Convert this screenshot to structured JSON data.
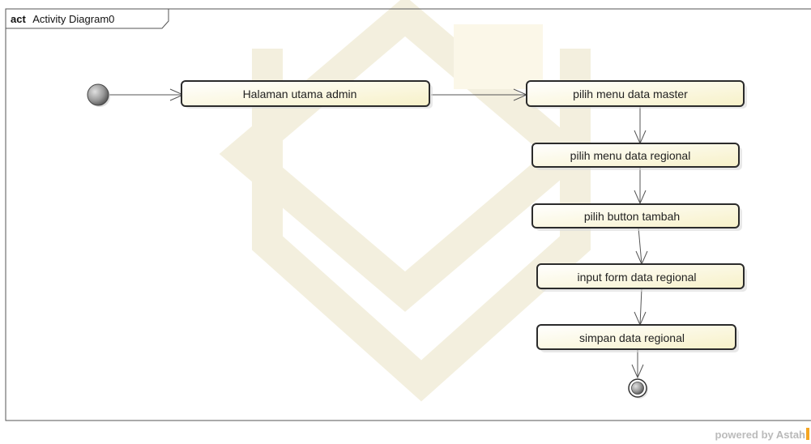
{
  "frame": {
    "keyword": "act",
    "name": "Activity Diagram0"
  },
  "actions": [
    {
      "id": "a1",
      "label": "Halaman utama admin"
    },
    {
      "id": "a2",
      "label": "pilih menu data master"
    },
    {
      "id": "a3",
      "label": "pilih menu data regional"
    },
    {
      "id": "a4",
      "label": "pilih button tambah"
    },
    {
      "id": "a5",
      "label": "input form data regional"
    },
    {
      "id": "a6",
      "label": "simpan data regional"
    }
  ],
  "flows": [
    {
      "from": "initial",
      "to": "a1"
    },
    {
      "from": "a1",
      "to": "a2"
    },
    {
      "from": "a2",
      "to": "a3"
    },
    {
      "from": "a3",
      "to": "a4"
    },
    {
      "from": "a4",
      "to": "a5"
    },
    {
      "from": "a5",
      "to": "a6"
    },
    {
      "from": "a6",
      "to": "final"
    }
  ],
  "footer": {
    "powered_prefix": "powered by ",
    "powered_brand": "Astah"
  },
  "colors": {
    "action_fill": "#fdfbe3",
    "action_stroke": "#2b2b2b",
    "watermark": "#f3efde",
    "node_fill": "#8a8a8a"
  }
}
